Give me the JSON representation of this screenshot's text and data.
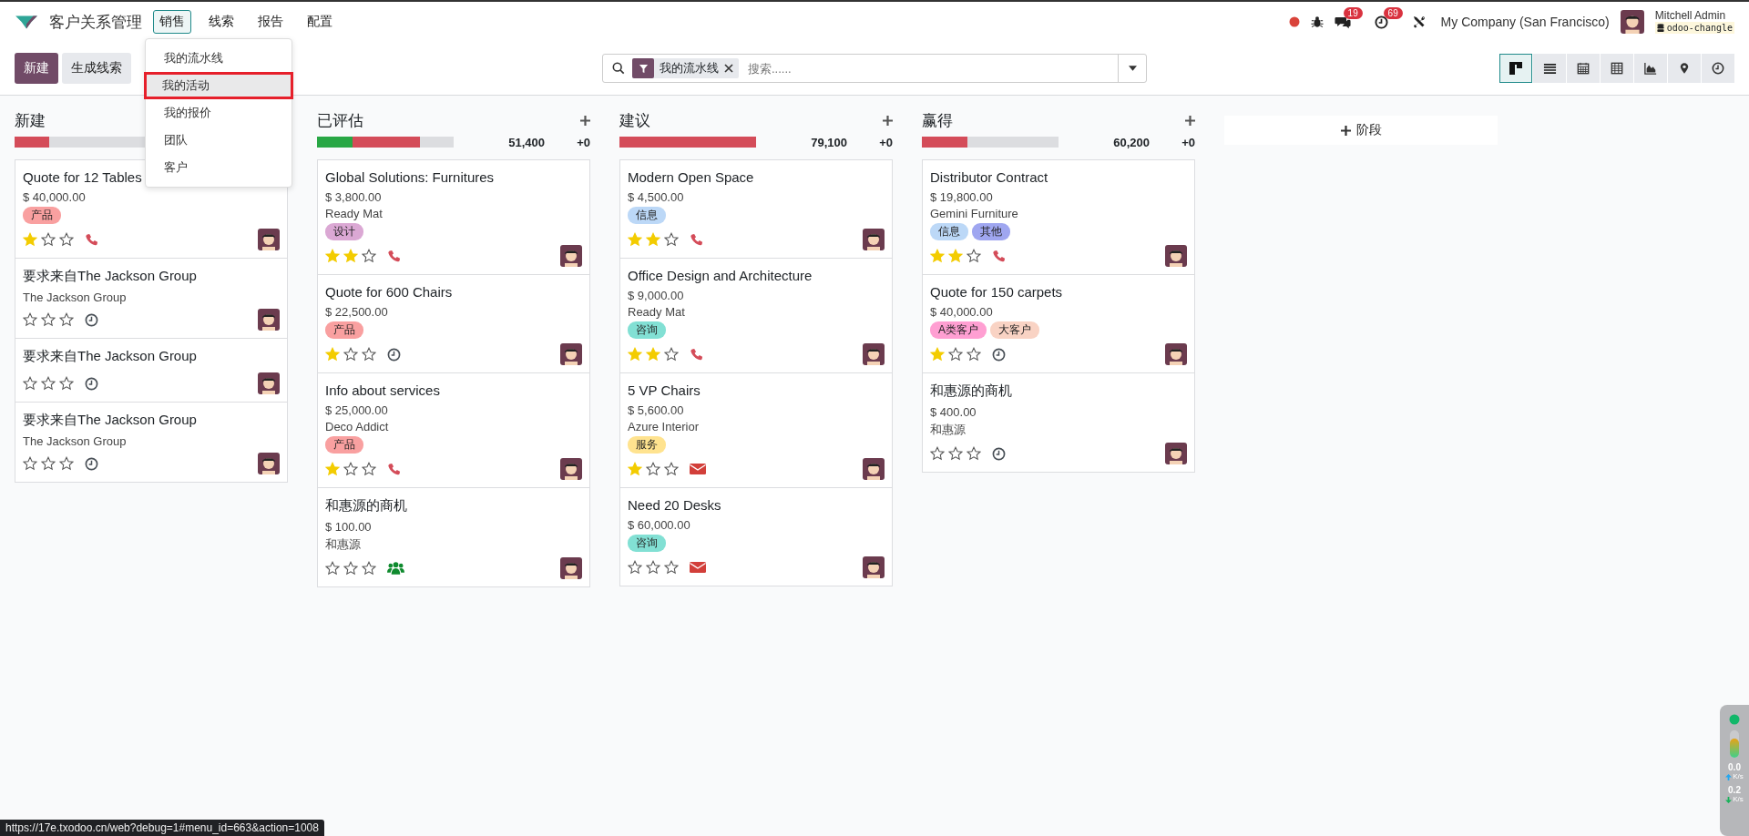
{
  "navbar": {
    "app_name": "客户关系管理",
    "menu": [
      {
        "label": "销售",
        "selected": true
      },
      {
        "label": "线索",
        "selected": false
      },
      {
        "label": "报告",
        "selected": false
      },
      {
        "label": "配置",
        "selected": false
      }
    ],
    "chat_count": "19",
    "activity_count": "69",
    "company": "My Company (San Francisco)",
    "user": "Mitchell Admin",
    "database": "odoo-changle"
  },
  "dropdown": {
    "items": [
      {
        "label": "我的流水线",
        "highlighted": false
      },
      {
        "label": "我的活动",
        "highlighted": true
      },
      {
        "label": "我的报价",
        "highlighted": false
      },
      {
        "label": "团队",
        "highlighted": false
      },
      {
        "label": "客户",
        "highlighted": false
      }
    ]
  },
  "control_panel": {
    "buttons": [
      {
        "label": "新建",
        "kind": "primary"
      },
      {
        "label": "生成线索",
        "kind": "secondary"
      }
    ],
    "search": {
      "facet": "我的流水线",
      "placeholder": "搜索......"
    },
    "views": [
      {
        "kind": "kanban",
        "selected": true
      },
      {
        "kind": "list",
        "selected": false
      },
      {
        "kind": "calendar",
        "selected": false
      },
      {
        "kind": "pivot",
        "selected": false
      },
      {
        "kind": "graph",
        "selected": false
      },
      {
        "kind": "map",
        "selected": false
      },
      {
        "kind": "activity",
        "selected": false
      }
    ]
  },
  "columns": [
    {
      "title": "新建",
      "progress": [
        {
          "color": "#d44c59",
          "level": 0.25
        },
        {
          "color": "#dcdde0",
          "level": 0.75
        }
      ],
      "cards": [
        {
          "title": "Quote for 12 Tables",
          "amount": "$ 40,000.00",
          "tags": [
            {
              "label": "产品",
              "color": "#f9a0a0"
            }
          ],
          "stars": 1,
          "activity": {
            "kind": "phone"
          }
        },
        {
          "title": "要求来自The Jackson Group",
          "company": "The Jackson Group",
          "stars": 0,
          "activity": {
            "kind": "clock"
          }
        },
        {
          "title": "要求来自The Jackson Group",
          "stars": 0,
          "activity": {
            "kind": "clock"
          }
        },
        {
          "title": "要求来自The Jackson Group",
          "company": "The Jackson Group",
          "stars": 0,
          "activity": {
            "kind": "clock"
          }
        }
      ]
    },
    {
      "title": "已评估",
      "total": "51,400",
      "count": "+0",
      "progress": [
        {
          "color": "#28a745",
          "level": 0.26
        },
        {
          "color": "#d44c59",
          "level": 0.49
        },
        {
          "color": "#dcdde0",
          "level": 0.25
        }
      ],
      "cards": [
        {
          "title": "Global Solutions: Furnitures",
          "amount": "$ 3,800.00",
          "company": "Ready Mat",
          "tags": [
            {
              "label": "设计",
              "color": "#dba8d4"
            }
          ],
          "stars": 2,
          "activity": {
            "kind": "phone"
          }
        },
        {
          "title": "Quote for 600 Chairs",
          "amount": "$ 22,500.00",
          "tags": [
            {
              "label": "产品",
              "color": "#f9a0a0"
            }
          ],
          "stars": 1,
          "activity": {
            "kind": "clock"
          }
        },
        {
          "title": "Info about services",
          "amount": "$ 25,000.00",
          "company": "Deco Addict",
          "tags": [
            {
              "label": "产品",
              "color": "#f9a0a0"
            }
          ],
          "stars": 1,
          "activity": {
            "kind": "phone"
          }
        },
        {
          "title": "和惠源的商机",
          "amount": "$ 100.00",
          "company": "和惠源",
          "stars": 0,
          "activity": {
            "kind": "group"
          }
        }
      ]
    },
    {
      "title": "建议",
      "total": "79,100",
      "count": "+0",
      "progress": [
        {
          "color": "#d44c59",
          "level": 1
        }
      ],
      "cards": [
        {
          "title": "Modern Open Space",
          "amount": "$ 4,500.00",
          "tags": [
            {
              "label": "信息",
              "color": "#bcd8f7"
            }
          ],
          "stars": 2,
          "activity": {
            "kind": "phone"
          }
        },
        {
          "title": "Office Design and Architecture",
          "amount": "$ 9,000.00",
          "company": "Ready Mat",
          "tags": [
            {
              "label": "咨询",
              "color": "#82e0d4"
            }
          ],
          "stars": 2,
          "activity": {
            "kind": "phone"
          }
        },
        {
          "title": "5 VP Chairs",
          "amount": "$ 5,600.00",
          "company": "Azure Interior",
          "tags": [
            {
              "label": "服务",
              "color": "#ffe38f"
            }
          ],
          "stars": 1,
          "activity": {
            "kind": "email"
          }
        },
        {
          "title": "Need 20 Desks",
          "amount": "$ 60,000.00",
          "tags": [
            {
              "label": "咨询",
              "color": "#82e0d4"
            }
          ],
          "stars": 0,
          "activity": {
            "kind": "email"
          }
        }
      ]
    },
    {
      "title": "赢得",
      "total": "60,200",
      "count": "+0",
      "progress": [
        {
          "color": "#d44c59",
          "level": 0.33
        },
        {
          "color": "#dcdde0",
          "level": 0.67
        }
      ],
      "cards": [
        {
          "title": "Distributor Contract",
          "amount": "$ 19,800.00",
          "company": "Gemini Furniture",
          "tags": [
            {
              "label": "信息",
              "color": "#bcd8f7"
            },
            {
              "label": "其他",
              "color": "#9fa6f0"
            }
          ],
          "stars": 2,
          "activity": {
            "kind": "phone"
          }
        },
        {
          "title": "Quote for 150 carpets",
          "amount": "$ 40,000.00",
          "tags": [
            {
              "label": "A类客户",
              "color": "#ff9fd2"
            },
            {
              "label": "大客户",
              "color": "#f9d3c4"
            }
          ],
          "stars": 1,
          "activity": {
            "kind": "clock"
          }
        },
        {
          "title": "和惠源的商机",
          "amount": "$ 400.00",
          "company": "和惠源",
          "stars": 0,
          "activity": {
            "kind": "clock"
          }
        }
      ]
    }
  ],
  "add_stage": "阶段",
  "status_url": "https://17e.txodoo.cn/web?debug=1#menu_id=663&action=1008",
  "net_widget": {
    "up": "0.0",
    "up_unit": "K/s",
    "down": "0.2",
    "down_unit": "K/s"
  }
}
